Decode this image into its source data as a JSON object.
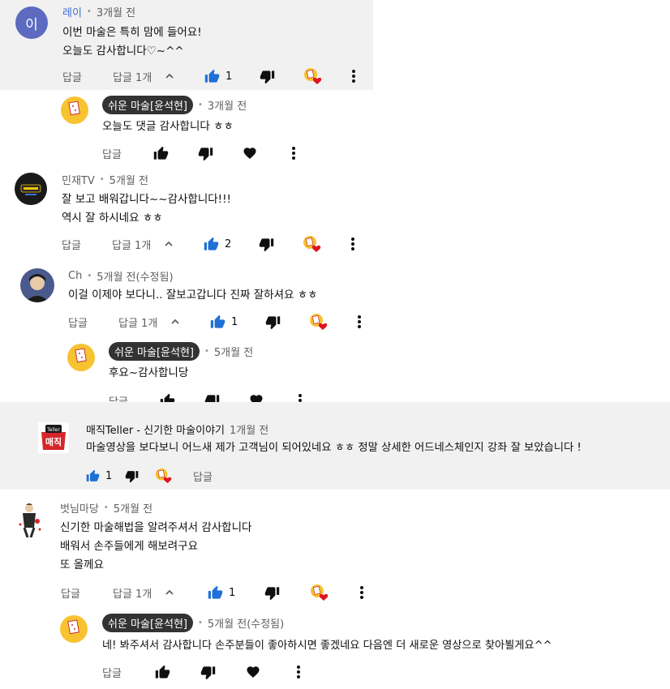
{
  "colors": {
    "grey_bg": "#f1f1f1",
    "like_blue": "#1f6fd6",
    "heart_red": "#e0141d",
    "owner_pill": "#333333"
  },
  "labels": {
    "reply": "답글",
    "dot": "•"
  },
  "comments": [
    {
      "avatar_letter": "이",
      "author": "레이",
      "time": "3개월 전",
      "lines": [
        "이번 마술은 특히 맘에 들어요!",
        "오늘도 감사합니다♡~^^"
      ],
      "replies_label": "답글 1개",
      "likes": "1",
      "reply": {
        "author": "쉬운 마술[윤석현]",
        "time": "3개월 전",
        "text": "오늘도 댓글 감사합니다 ㅎㅎ"
      }
    },
    {
      "author": "민재TV",
      "time": "5개월 전",
      "lines": [
        "잘 보고 배워갑니다~~감사합니다!!!",
        "역시 잘 하시네요 ㅎㅎ"
      ],
      "replies_label": "답글 1개",
      "likes": "2"
    },
    {
      "author": "Ch",
      "time": "5개월 전(수정됨)",
      "lines": [
        "이걸  이제야 보다니.. 잘보고갑니다 진짜 잘하셔요 ㅎㅎ"
      ],
      "replies_label": "답글 1개",
      "likes": "1",
      "reply": {
        "author": "쉬운 마술[윤석현]",
        "time": "5개월 전",
        "text": "후요~감사합니당"
      }
    },
    {
      "author": "매직Teller - 신기한 마술이야기",
      "time": "1개월 전",
      "lines": [
        "마술영상을 보다보니 어느새 제가 고객님이 되어있네요 ㅎㅎ 정말 상세한 어드네스체인지 강좌 잘 보았습니다 !"
      ],
      "likes": "1"
    },
    {
      "author": "벗님마당",
      "time": "5개월 전",
      "lines": [
        "신기한 마술해법을 알려주셔서 감사합니다",
        "배워서 손주들에게 해보려구요",
        "또 올께요"
      ],
      "replies_label": "답글 1개",
      "likes": "1",
      "reply": {
        "author": "쉬운 마술[윤석현]",
        "time": "5개월 전(수정됨)",
        "text": "네! 봐주셔서 감사합니다 손주분들이 좋아하시면 좋겠네요 다음엔 더 새로운 영상으로 찾아뵐게요^^"
      }
    }
  ]
}
